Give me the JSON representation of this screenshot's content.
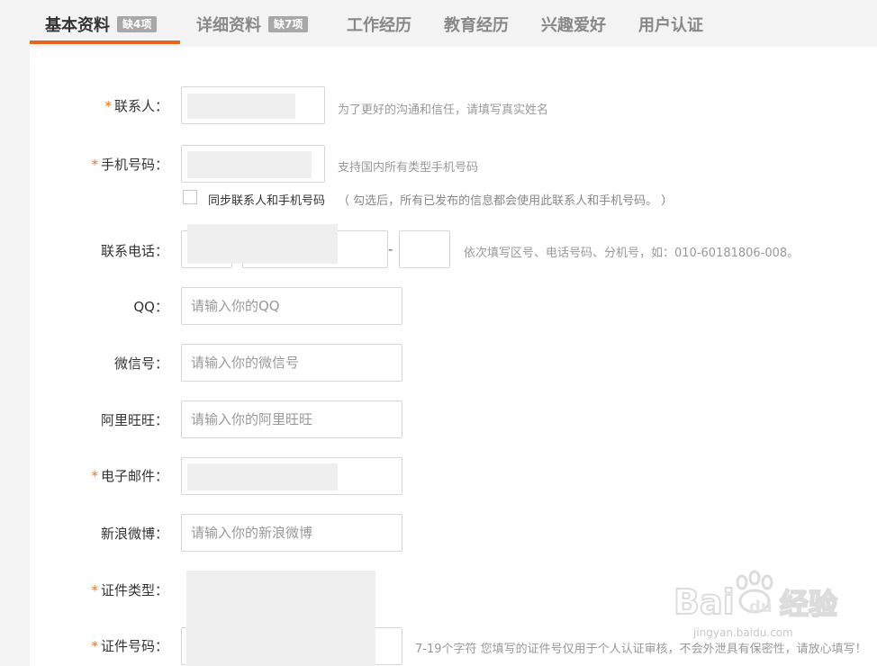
{
  "tabs": [
    {
      "label": "基本资料",
      "badge": "缺4项"
    },
    {
      "label": "详细资料",
      "badge": "缺7项"
    },
    {
      "label": "工作经历"
    },
    {
      "label": "教育经历"
    },
    {
      "label": "兴趣爱好"
    },
    {
      "label": "用户认证"
    }
  ],
  "form": {
    "required_mark": "*",
    "contact": {
      "label": "联系人：",
      "hint": "为了更好的沟通和信任，请填写真实姓名",
      "value": ""
    },
    "mobile": {
      "label": "手机号码：",
      "hint": "支持国内所有类型手机号码",
      "value": ""
    },
    "sync": {
      "label": "同步联系人和手机号码",
      "note": "（ 勾选后，所有已发布的信息都会使用此联系人和手机号码。 ）"
    },
    "phone": {
      "label": "联系电话：",
      "separator": "-",
      "hint": "依次填写区号、电话号码、分机号，如：010-60181806-008。"
    },
    "qq": {
      "label": "QQ：",
      "placeholder": "请输入你的QQ"
    },
    "wechat": {
      "label": "微信号：",
      "placeholder": "请输入你的微信号"
    },
    "aliwangwang": {
      "label": "阿里旺旺：",
      "placeholder": "请输入你的阿里旺旺"
    },
    "email": {
      "label": "电子邮件：",
      "value": ""
    },
    "weibo": {
      "label": "新浪微博：",
      "placeholder": "请输入你的新浪微博"
    },
    "id_type": {
      "label": "证件类型："
    },
    "id_number": {
      "label": "证件号码：",
      "hint": "7-19个字符 您填写的证件号仅用于个人认证审核，不会外泄具有保密性，请放心填写！"
    }
  },
  "watermark": {
    "brand": "Bai",
    "brand2": "du",
    "suffix": "经验",
    "url": "jingyan.baidu.com"
  },
  "colors": {
    "accent": "#e8641b",
    "required": "#f4721d",
    "badge": "#a8a8a8"
  }
}
